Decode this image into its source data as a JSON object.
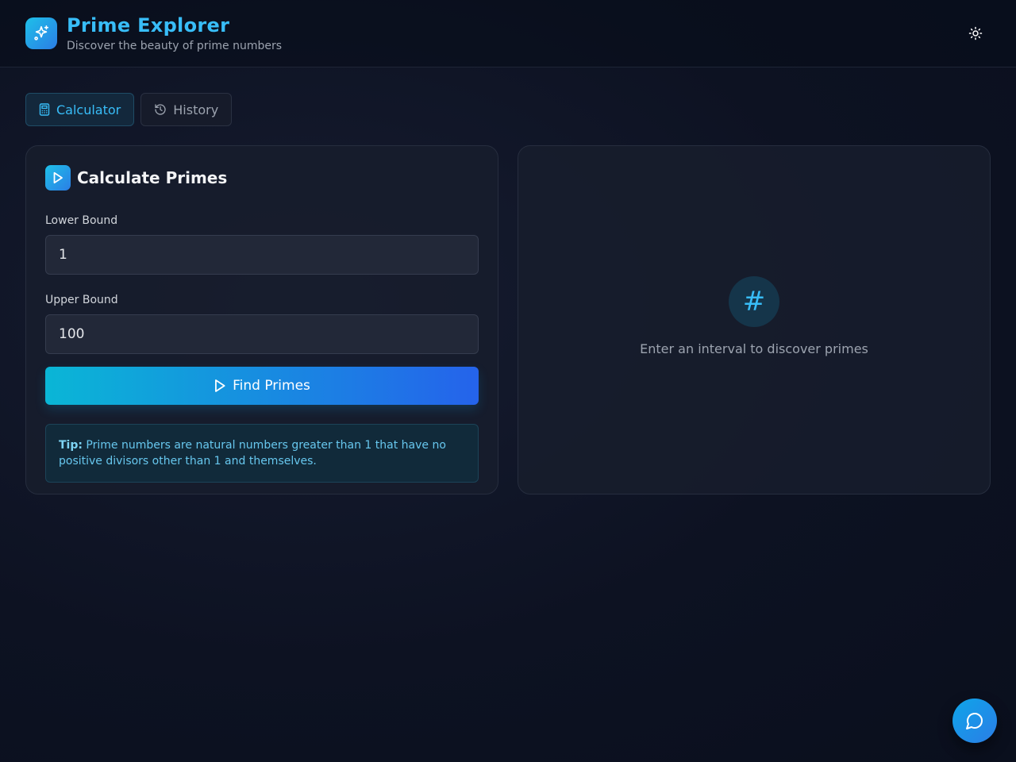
{
  "header": {
    "title": "Prime Explorer",
    "subtitle": "Discover the beauty of prime numbers",
    "logo_icon": "sparkles-icon",
    "theme_icon": "sun-icon"
  },
  "tabs": [
    {
      "label": "Calculator",
      "icon": "calculator-icon",
      "active": true
    },
    {
      "label": "History",
      "icon": "history-icon",
      "active": false
    }
  ],
  "calculator": {
    "title": "Calculate Primes",
    "lower_label": "Lower Bound",
    "lower_value": "1",
    "upper_label": "Upper Bound",
    "upper_value": "100",
    "button_label": "Find Primes",
    "tip_prefix": "Tip:",
    "tip_text": "Prime numbers are natural numbers greater than 1 that have no positive divisors other than 1 and themselves."
  },
  "results": {
    "empty_symbol": "#",
    "empty_text": "Enter an interval to discover primes"
  },
  "colors": {
    "accent": "#38bdf8",
    "gradient_start": "#0ab6d6",
    "gradient_end": "#2563eb",
    "background": "#0d1222"
  }
}
